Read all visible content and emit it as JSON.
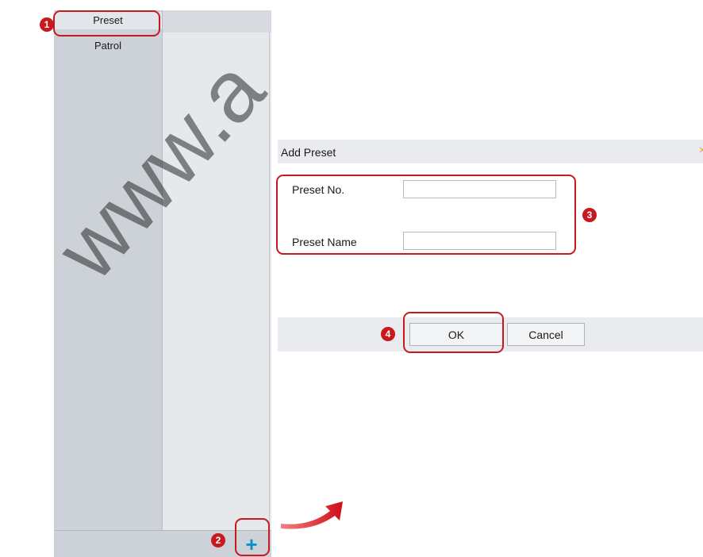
{
  "panel": {
    "tabs": [
      {
        "label": "Preset"
      },
      {
        "label": "Patrol"
      }
    ],
    "add_icon_glyph": "+"
  },
  "dialog": {
    "title": "Add Preset",
    "close_glyph": "×",
    "preset_no_label": "Preset No.",
    "preset_no_value": "",
    "preset_name_label": "Preset Name",
    "preset_name_value": "",
    "ok_label": "OK",
    "cancel_label": "Cancel"
  },
  "callouts": [
    "1",
    "2",
    "3",
    "4"
  ],
  "watermark": "www.a",
  "colors": {
    "callout": "#c8191f",
    "add_icon": "#0e8fc8",
    "close_icon": "#e8a63a"
  }
}
